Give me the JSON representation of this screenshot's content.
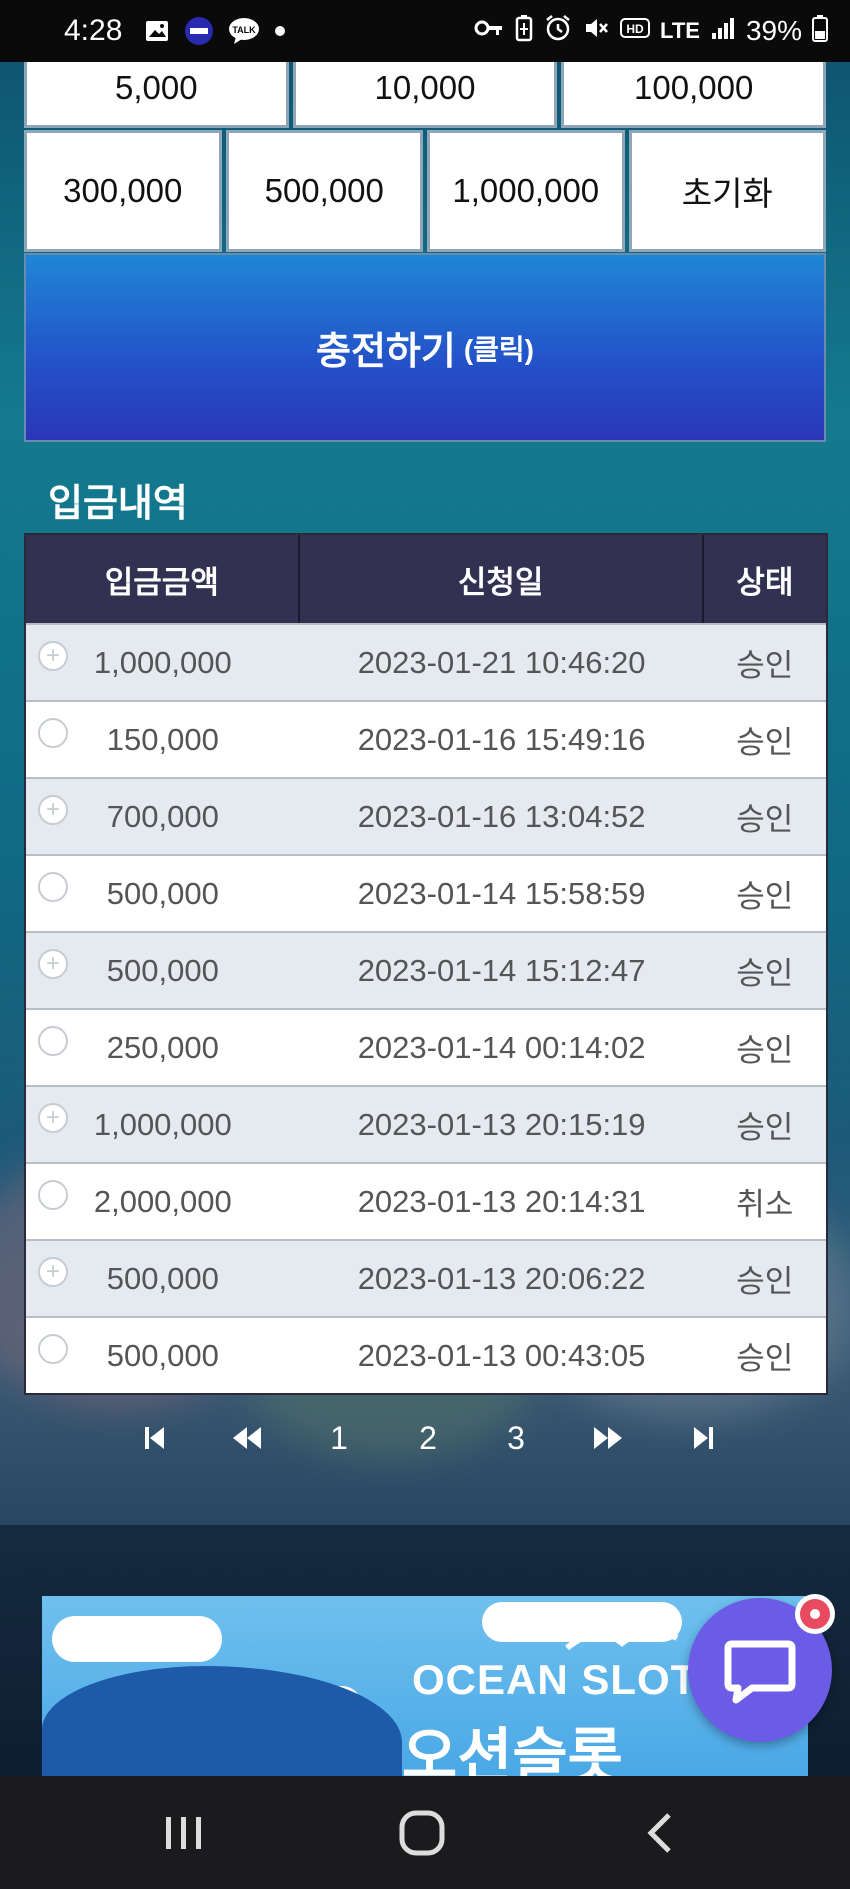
{
  "status_bar": {
    "time": "4:28",
    "network": "LTE",
    "battery": "39%",
    "icons": [
      "gallery-icon",
      "app-icon",
      "talk-icon",
      "dot-icon",
      "key-icon",
      "battery-saver-icon",
      "alarm-icon",
      "mute-icon",
      "hd-icon",
      "signal-icon",
      "battery-icon"
    ],
    "talk_label": "TALK"
  },
  "amounts": {
    "top_row": [
      "5,000",
      "10,000",
      "100,000"
    ],
    "bottom_row": [
      "300,000",
      "500,000",
      "1,000,000"
    ],
    "reset_label": "초기화"
  },
  "charge_button": {
    "label": "충전하기",
    "sub": "(클릭)"
  },
  "history": {
    "title": "입금내역",
    "columns": [
      "입금금액",
      "신청일",
      "상태"
    ],
    "rows": [
      {
        "amount": "1,000,000",
        "date": "2023-01-21 10:46:20",
        "status": "승인"
      },
      {
        "amount": "150,000",
        "date": "2023-01-16 15:49:16",
        "status": "승인"
      },
      {
        "amount": "700,000",
        "date": "2023-01-16 13:04:52",
        "status": "승인"
      },
      {
        "amount": "500,000",
        "date": "2023-01-14 15:58:59",
        "status": "승인"
      },
      {
        "amount": "500,000",
        "date": "2023-01-14 15:12:47",
        "status": "승인"
      },
      {
        "amount": "250,000",
        "date": "2023-01-14 00:14:02",
        "status": "승인"
      },
      {
        "amount": "1,000,000",
        "date": "2023-01-13 20:15:19",
        "status": "승인"
      },
      {
        "amount": "2,000,000",
        "date": "2023-01-13 20:14:31",
        "status": "취소"
      },
      {
        "amount": "500,000",
        "date": "2023-01-13 20:06:22",
        "status": "승인"
      },
      {
        "amount": "500,000",
        "date": "2023-01-13 00:43:05",
        "status": "승인"
      }
    ]
  },
  "pagination": {
    "pages": [
      "1",
      "2",
      "3"
    ]
  },
  "banner": {
    "title_en": "OCEAN SLOT",
    "title_ko": "오션슬롯"
  },
  "colors": {
    "charge_button": "#2450c8",
    "table_header": "#333152",
    "chat_fab": "#6b5ce7",
    "chat_badge": "#e84a5f"
  }
}
